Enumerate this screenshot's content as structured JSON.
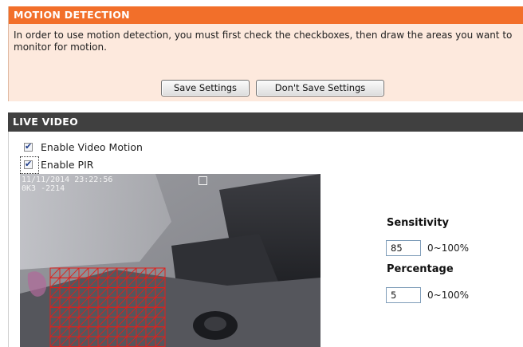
{
  "motion_detection": {
    "title": "MOTION DETECTION",
    "description": "In order to use motion detection, you must first check the checkboxes, then draw the areas you want to monitor for motion.",
    "save_label": "Save Settings",
    "dont_save_label": "Don't Save Settings"
  },
  "live_video": {
    "title": "LIVE VIDEO",
    "enable_video_motion": {
      "label": "Enable Video Motion",
      "checked": true
    },
    "enable_pir": {
      "label": "Enable PIR",
      "checked": true
    },
    "osd_text": "11/11/2014 23:22:56\n0K3 -2214"
  },
  "sensitivity": {
    "label": "Sensitivity",
    "value": "85",
    "range": "0~100%"
  },
  "percentage": {
    "label": "Percentage",
    "value": "5",
    "range": "0~100%"
  },
  "colors": {
    "header_orange": "#f26f2a",
    "panel_peach": "#fde9dd",
    "header_dark": "#404040",
    "grid_red": "#e0201c"
  },
  "motion_grid": {
    "cols_selected": 12,
    "rows_selected": 8
  }
}
